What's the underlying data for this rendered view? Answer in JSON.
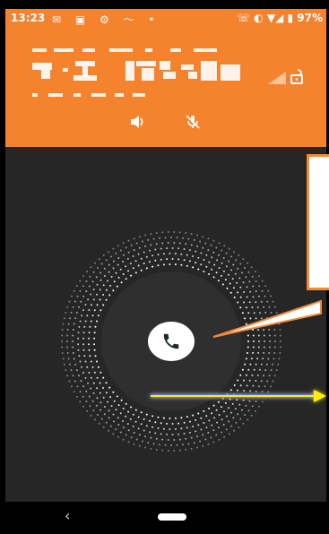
{
  "status_bar": {
    "time": "13:23",
    "left_icons": "✉ ▣ ⚙ 〜 •",
    "battery_text": "97%",
    "right_icons": "☏ ◐ ▼◢ ▮"
  },
  "call_header": {
    "caller_name_obscured": true,
    "icons": [
      "signal-weak-icon",
      "lock-open-icon",
      "speaker-icon",
      "mic-off-icon"
    ]
  },
  "call_body": {
    "answer_icon": "phone-icon",
    "annotations": [
      "callout-box",
      "swipe-hint-arrow"
    ]
  },
  "nav_bar": {
    "back_glyph": "‹"
  },
  "colors": {
    "header": "#f5822d",
    "body": "#262626",
    "callout_border": "#f08a3e",
    "hint_arrow": "#ffee00"
  }
}
